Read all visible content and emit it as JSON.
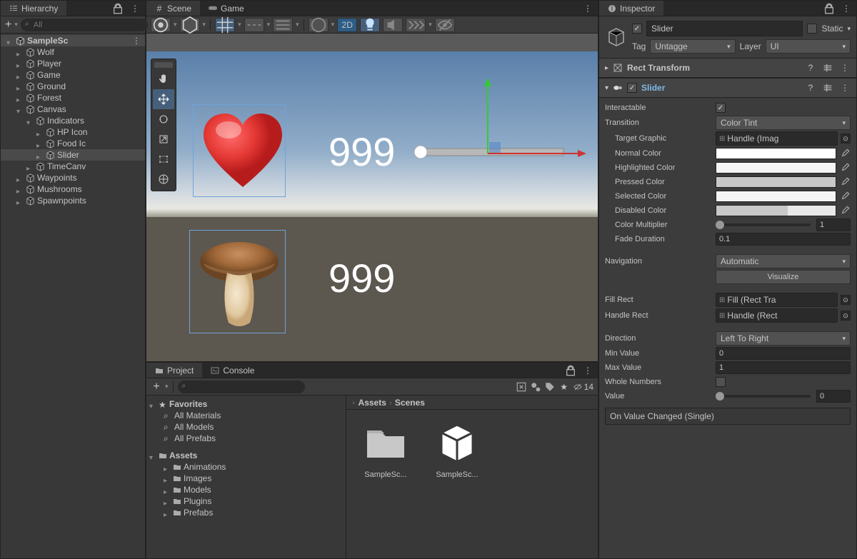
{
  "hierarchy": {
    "title": "Hierarchy",
    "search_placeholder": "All",
    "scene_name": "SampleSc",
    "items": [
      {
        "label": "Wolf",
        "depth": 1
      },
      {
        "label": "Player",
        "depth": 1
      },
      {
        "label": "Game",
        "depth": 1
      },
      {
        "label": "Ground",
        "depth": 1
      },
      {
        "label": "Forest",
        "depth": 1
      },
      {
        "label": "Canvas",
        "depth": 1,
        "expanded": true
      },
      {
        "label": "Indicators",
        "depth": 2,
        "expanded": true
      },
      {
        "label": "HP Icon",
        "depth": 3
      },
      {
        "label": "Food Ic",
        "depth": 3
      },
      {
        "label": "Slider",
        "depth": 3,
        "selected": true
      },
      {
        "label": "TimeCanv",
        "depth": 2
      },
      {
        "label": "Waypoints",
        "depth": 1
      },
      {
        "label": "Mushrooms",
        "depth": 1
      },
      {
        "label": "Spawnpoints",
        "depth": 1
      }
    ]
  },
  "scene": {
    "tab_scene": "Scene",
    "tab_game": "Game",
    "btn_2d": "2D",
    "hp_value": "999",
    "food_value": "999"
  },
  "project": {
    "tab_project": "Project",
    "tab_console": "Console",
    "count": "14",
    "favorites_label": "Favorites",
    "fav_items": [
      "All Materials",
      "All Models",
      "All Prefabs"
    ],
    "assets_label": "Assets",
    "asset_folders": [
      "Animations",
      "Images",
      "Models",
      "Plugins",
      "Prefabs"
    ],
    "breadcrumb": [
      "Assets",
      "Scenes"
    ],
    "grid_items": [
      "SampleSc...",
      "SampleSc..."
    ]
  },
  "inspector": {
    "title": "Inspector",
    "name": "Slider",
    "static_label": "Static",
    "tag_label": "Tag",
    "tag_value": "Untagge",
    "layer_label": "Layer",
    "layer_value": "UI",
    "rect_transform": "Rect Transform",
    "slider_comp": "Slider",
    "interactable": "Interactable",
    "transition": {
      "label": "Transition",
      "value": "Color Tint"
    },
    "target_graphic": {
      "label": "Target Graphic",
      "value": "Handle (Imag"
    },
    "normal_color": {
      "label": "Normal Color",
      "value": "#ffffff"
    },
    "highlighted_color": {
      "label": "Highlighted Color",
      "value": "#f5f5f5"
    },
    "pressed_color": {
      "label": "Pressed Color",
      "value": "#c8c8c8"
    },
    "selected_color": {
      "label": "Selected Color",
      "value": "#f5f5f5"
    },
    "disabled_color": {
      "label": "Disabled Color",
      "value_left": "#c8c8c8",
      "value_right": "#e0e0e0"
    },
    "color_multiplier": {
      "label": "Color Multiplier",
      "value": "1"
    },
    "fade_duration": {
      "label": "Fade Duration",
      "value": "0.1"
    },
    "navigation": {
      "label": "Navigation",
      "value": "Automatic"
    },
    "visualize": "Visualize",
    "fill_rect": {
      "label": "Fill Rect",
      "value": "Fill (Rect Tra"
    },
    "handle_rect": {
      "label": "Handle Rect",
      "value": "Handle (Rect"
    },
    "direction": {
      "label": "Direction",
      "value": "Left To Right"
    },
    "min_value": {
      "label": "Min Value",
      "value": "0"
    },
    "max_value": {
      "label": "Max Value",
      "value": "1"
    },
    "whole_numbers": {
      "label": "Whole Numbers"
    },
    "value_prop": {
      "label": "Value",
      "value": "0"
    },
    "event_label": "On Value Changed (Single)"
  }
}
